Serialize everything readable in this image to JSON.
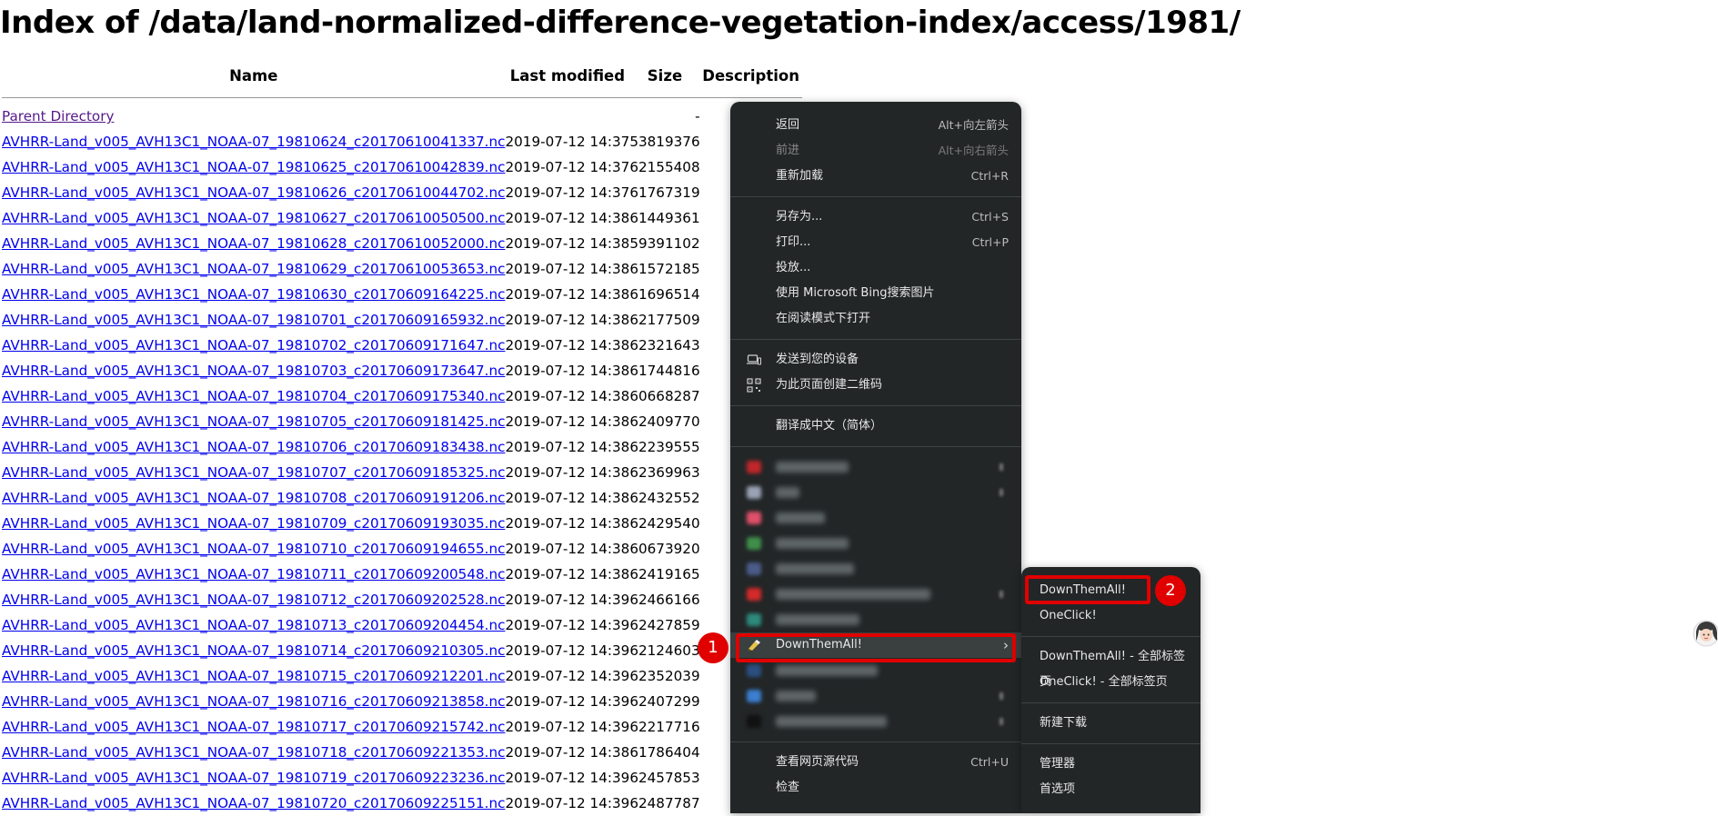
{
  "page": {
    "title": "Index of /data/land-normalized-difference-vegetation-index/access/1981/",
    "columns": {
      "name": "Name",
      "last_modified": "Last modified",
      "size": "Size",
      "description": "Description"
    },
    "parent": {
      "label": "Parent Directory",
      "size": "-"
    },
    "files": [
      {
        "name": "AVHRR-Land_v005_AVH13C1_NOAA-07_19810624_c20170610041337.nc",
        "modified": "2019-07-12 14:37",
        "size": "53819376"
      },
      {
        "name": "AVHRR-Land_v005_AVH13C1_NOAA-07_19810625_c20170610042839.nc",
        "modified": "2019-07-12 14:37",
        "size": "62155408"
      },
      {
        "name": "AVHRR-Land_v005_AVH13C1_NOAA-07_19810626_c20170610044702.nc",
        "modified": "2019-07-12 14:37",
        "size": "61767319"
      },
      {
        "name": "AVHRR-Land_v005_AVH13C1_NOAA-07_19810627_c20170610050500.nc",
        "modified": "2019-07-12 14:38",
        "size": "61449361"
      },
      {
        "name": "AVHRR-Land_v005_AVH13C1_NOAA-07_19810628_c20170610052000.nc",
        "modified": "2019-07-12 14:38",
        "size": "59391102"
      },
      {
        "name": "AVHRR-Land_v005_AVH13C1_NOAA-07_19810629_c20170610053653.nc",
        "modified": "2019-07-12 14:38",
        "size": "61572185"
      },
      {
        "name": "AVHRR-Land_v005_AVH13C1_NOAA-07_19810630_c20170609164225.nc",
        "modified": "2019-07-12 14:38",
        "size": "61696514"
      },
      {
        "name": "AVHRR-Land_v005_AVH13C1_NOAA-07_19810701_c20170609165932.nc",
        "modified": "2019-07-12 14:38",
        "size": "62177509"
      },
      {
        "name": "AVHRR-Land_v005_AVH13C1_NOAA-07_19810702_c20170609171647.nc",
        "modified": "2019-07-12 14:38",
        "size": "62321643"
      },
      {
        "name": "AVHRR-Land_v005_AVH13C1_NOAA-07_19810703_c20170609173647.nc",
        "modified": "2019-07-12 14:38",
        "size": "61744816"
      },
      {
        "name": "AVHRR-Land_v005_AVH13C1_NOAA-07_19810704_c20170609175340.nc",
        "modified": "2019-07-12 14:38",
        "size": "60668287"
      },
      {
        "name": "AVHRR-Land_v005_AVH13C1_NOAA-07_19810705_c20170609181425.nc",
        "modified": "2019-07-12 14:38",
        "size": "62409770"
      },
      {
        "name": "AVHRR-Land_v005_AVH13C1_NOAA-07_19810706_c20170609183438.nc",
        "modified": "2019-07-12 14:38",
        "size": "62239555"
      },
      {
        "name": "AVHRR-Land_v005_AVH13C1_NOAA-07_19810707_c20170609185325.nc",
        "modified": "2019-07-12 14:38",
        "size": "62369963"
      },
      {
        "name": "AVHRR-Land_v005_AVH13C1_NOAA-07_19810708_c20170609191206.nc",
        "modified": "2019-07-12 14:38",
        "size": "62432552"
      },
      {
        "name": "AVHRR-Land_v005_AVH13C1_NOAA-07_19810709_c20170609193035.nc",
        "modified": "2019-07-12 14:38",
        "size": "62429540"
      },
      {
        "name": "AVHRR-Land_v005_AVH13C1_NOAA-07_19810710_c20170609194655.nc",
        "modified": "2019-07-12 14:38",
        "size": "60673920"
      },
      {
        "name": "AVHRR-Land_v005_AVH13C1_NOAA-07_19810711_c20170609200548.nc",
        "modified": "2019-07-12 14:38",
        "size": "62419165"
      },
      {
        "name": "AVHRR-Land_v005_AVH13C1_NOAA-07_19810712_c20170609202528.nc",
        "modified": "2019-07-12 14:39",
        "size": "62466166"
      },
      {
        "name": "AVHRR-Land_v005_AVH13C1_NOAA-07_19810713_c20170609204454.nc",
        "modified": "2019-07-12 14:39",
        "size": "62427859"
      },
      {
        "name": "AVHRR-Land_v005_AVH13C1_NOAA-07_19810714_c20170609210305.nc",
        "modified": "2019-07-12 14:39",
        "size": "62124603"
      },
      {
        "name": "AVHRR-Land_v005_AVH13C1_NOAA-07_19810715_c20170609212201.nc",
        "modified": "2019-07-12 14:39",
        "size": "62352039"
      },
      {
        "name": "AVHRR-Land_v005_AVH13C1_NOAA-07_19810716_c20170609213858.nc",
        "modified": "2019-07-12 14:39",
        "size": "62407299"
      },
      {
        "name": "AVHRR-Land_v005_AVH13C1_NOAA-07_19810717_c20170609215742.nc",
        "modified": "2019-07-12 14:39",
        "size": "62217716"
      },
      {
        "name": "AVHRR-Land_v005_AVH13C1_NOAA-07_19810718_c20170609221353.nc",
        "modified": "2019-07-12 14:38",
        "size": "61786404"
      },
      {
        "name": "AVHRR-Land_v005_AVH13C1_NOAA-07_19810719_c20170609223236.nc",
        "modified": "2019-07-12 14:39",
        "size": "62457853"
      },
      {
        "name": "AVHRR-Land_v005_AVH13C1_NOAA-07_19810720_c20170609225151.nc",
        "modified": "2019-07-12 14:39",
        "size": "62487787"
      }
    ]
  },
  "context_menu": {
    "back": {
      "label": "返回",
      "shortcut": "Alt+向左箭头"
    },
    "forward": {
      "label": "前进",
      "shortcut": "Alt+向右箭头"
    },
    "reload": {
      "label": "重新加载",
      "shortcut": "Ctrl+R"
    },
    "save_as": {
      "label": "另存为...",
      "shortcut": "Ctrl+S"
    },
    "print": {
      "label": "打印...",
      "shortcut": "Ctrl+P"
    },
    "cast": {
      "label": "投放..."
    },
    "bing": {
      "label": "使用 Microsoft Bing搜索图片"
    },
    "reader": {
      "label": "在阅读模式下打开"
    },
    "send_device": {
      "label": "发送到您的设备",
      "icon": "laptop-phone-icon"
    },
    "qr": {
      "label": "为此页面创建二维码",
      "icon": "qr-code-icon"
    },
    "translate": {
      "label": "翻译成中文（简体）"
    },
    "downthemall": {
      "label": "DownThemAll!",
      "icon": "downthemall-icon"
    },
    "view_source": {
      "label": "查看网页源代码",
      "shortcut": "Ctrl+U"
    },
    "inspect": {
      "label": "检查"
    }
  },
  "submenu": {
    "items": [
      "DownThemAll!",
      "OneClick!",
      "DownThemAll! - 全部标签页",
      "OneClick! - 全部标签页",
      "新建下载",
      "管理器",
      "首选项"
    ]
  },
  "annotations": {
    "badge1": "1",
    "badge2": "2"
  },
  "colors": {
    "menu_bg": "#222627",
    "highlight": "#e00000",
    "link": "#0000ee",
    "visited": "#551a8b"
  }
}
